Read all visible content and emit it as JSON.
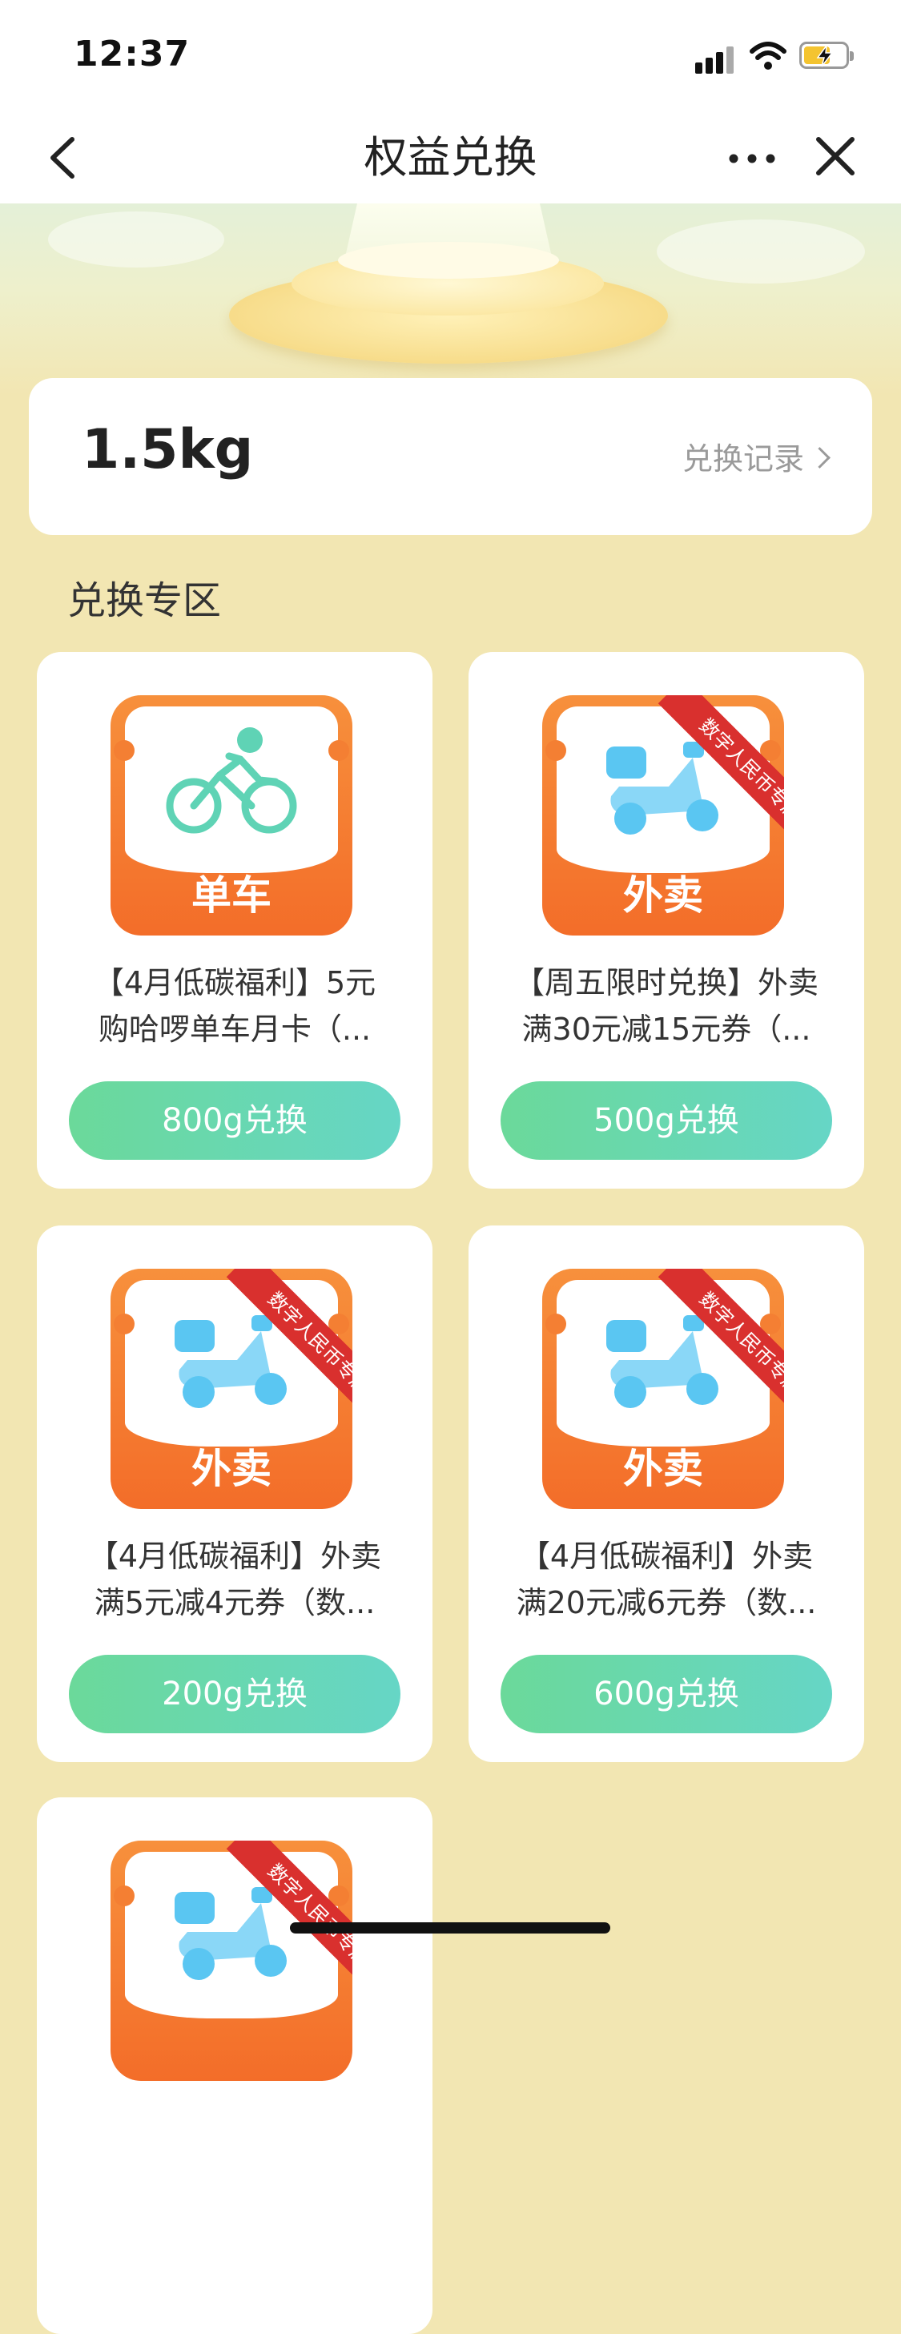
{
  "status_bar": {
    "time": "12:37"
  },
  "nav": {
    "title": "权益兑换",
    "back_icon": "chevron-left-icon",
    "more_icon": "more-dots-icon",
    "close_icon": "close-icon"
  },
  "balance": {
    "value": "1.5kg",
    "records_label": "兑换记录"
  },
  "section_title": "兑换专区",
  "products": [
    {
      "caption": "单车",
      "badge": "",
      "title_line1": "【4月低碳福利】5元",
      "title_line2": "购哈啰单车月卡（...",
      "button": "800g兑换",
      "icon": "bicycle-icon"
    },
    {
      "caption": "外卖",
      "badge": "数字人民币专属",
      "title_line1": "【周五限时兑换】外卖",
      "title_line2": "满30元减15元券（...",
      "button": "500g兑换",
      "icon": "scooter-icon"
    },
    {
      "caption": "外卖",
      "badge": "数字人民币专属",
      "title_line1": "【4月低碳福利】外卖",
      "title_line2": "满5元减4元券（数...",
      "button": "200g兑换",
      "icon": "scooter-icon"
    },
    {
      "caption": "外卖",
      "badge": "数字人民币专属",
      "title_line1": "【4月低碳福利】外卖",
      "title_line2": "满20元减6元券（数...",
      "button": "600g兑换",
      "icon": "scooter-icon"
    },
    {
      "caption": "",
      "badge": "数字人民币专属",
      "icon": "scooter-icon"
    }
  ],
  "colors": {
    "page_bg": "#f2e6b2",
    "button_gradient_start": "#6bd99a",
    "button_gradient_end": "#66d6c6",
    "ticket_orange": "#f36d29",
    "badge_red": "#d9302e"
  }
}
